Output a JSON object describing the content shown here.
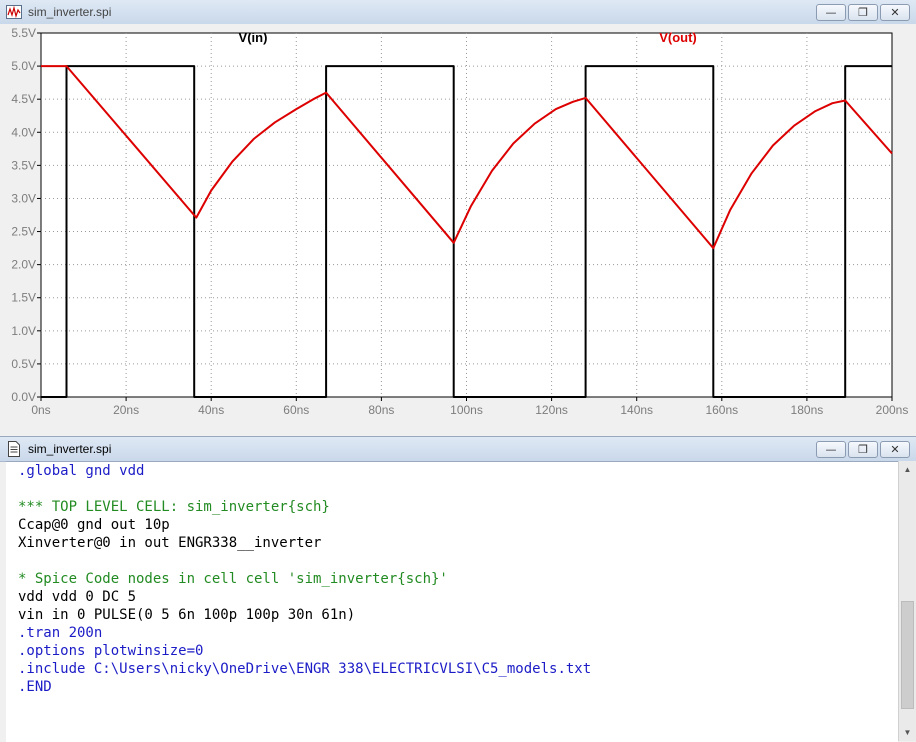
{
  "plot_window": {
    "title": "sim_inverter.spi",
    "icon": "waveform-icon"
  },
  "editor_window": {
    "title": "sim_inverter.spi",
    "icon": "document-icon"
  },
  "window_buttons": {
    "minimize": "—",
    "restore": "❐",
    "close": "✕"
  },
  "chart_data": {
    "type": "line",
    "xlabel": "",
    "ylabel": "",
    "xlim": [
      0,
      200
    ],
    "ylim": [
      0,
      5.5
    ],
    "x_ticks": [
      "0ns",
      "20ns",
      "40ns",
      "60ns",
      "80ns",
      "100ns",
      "120ns",
      "140ns",
      "160ns",
      "180ns",
      "200ns"
    ],
    "y_ticks": [
      "0.0V",
      "0.5V",
      "1.0V",
      "1.5V",
      "2.0V",
      "2.5V",
      "3.0V",
      "3.5V",
      "4.0V",
      "4.5V",
      "5.0V",
      "5.5V"
    ],
    "grid": true,
    "series": [
      {
        "name": "V(in)",
        "color": "#000000",
        "x": [
          0,
          6,
          6,
          36,
          36,
          67,
          67,
          97,
          97,
          128,
          128,
          158,
          158,
          189,
          189,
          200
        ],
        "y": [
          0,
          0,
          5,
          5,
          0,
          0,
          5,
          5,
          0,
          0,
          5,
          5,
          0,
          0,
          5,
          5
        ]
      },
      {
        "name": "V(out)",
        "color": "#dd0000",
        "x": [
          0,
          6,
          36.5,
          40,
          45,
          50,
          55,
          60,
          64,
          67,
          97,
          101,
          106,
          111,
          116,
          121,
          125,
          128,
          158,
          162,
          167,
          172,
          177,
          182,
          186,
          189,
          200
        ],
        "y": [
          5,
          5,
          2.71,
          3.12,
          3.56,
          3.9,
          4.15,
          4.35,
          4.5,
          4.6,
          2.33,
          2.88,
          3.42,
          3.83,
          4.13,
          4.35,
          4.46,
          4.52,
          2.25,
          2.83,
          3.38,
          3.8,
          4.1,
          4.32,
          4.44,
          4.48,
          3.68
        ]
      }
    ]
  },
  "netlist": [
    {
      "text": ".global gnd vdd",
      "color": "blue"
    },
    {
      "text": "",
      "color": "black"
    },
    {
      "text": "*** TOP LEVEL CELL: sim_inverter{sch}",
      "color": "green"
    },
    {
      "text": "Ccap@0 gnd out 10p",
      "color": "black"
    },
    {
      "text": "Xinverter@0 in out ENGR338__inverter",
      "color": "black"
    },
    {
      "text": "",
      "color": "black"
    },
    {
      "text": "* Spice Code nodes in cell cell 'sim_inverter{sch}'",
      "color": "green"
    },
    {
      "text": "vdd vdd 0 DC 5",
      "color": "black"
    },
    {
      "text": "vin in 0 PULSE(0 5 6n 100p 100p 30n 61n)",
      "color": "black"
    },
    {
      "text": ".tran 200n",
      "color": "blue"
    },
    {
      "text": ".options plotwinsize=0",
      "color": "blue"
    },
    {
      "text": ".include C:\\Users\\nicky\\OneDrive\\ENGR 338\\ELECTRICVLSI\\C5_models.txt",
      "color": "blue"
    },
    {
      "text": ".END",
      "color": "blue"
    }
  ]
}
